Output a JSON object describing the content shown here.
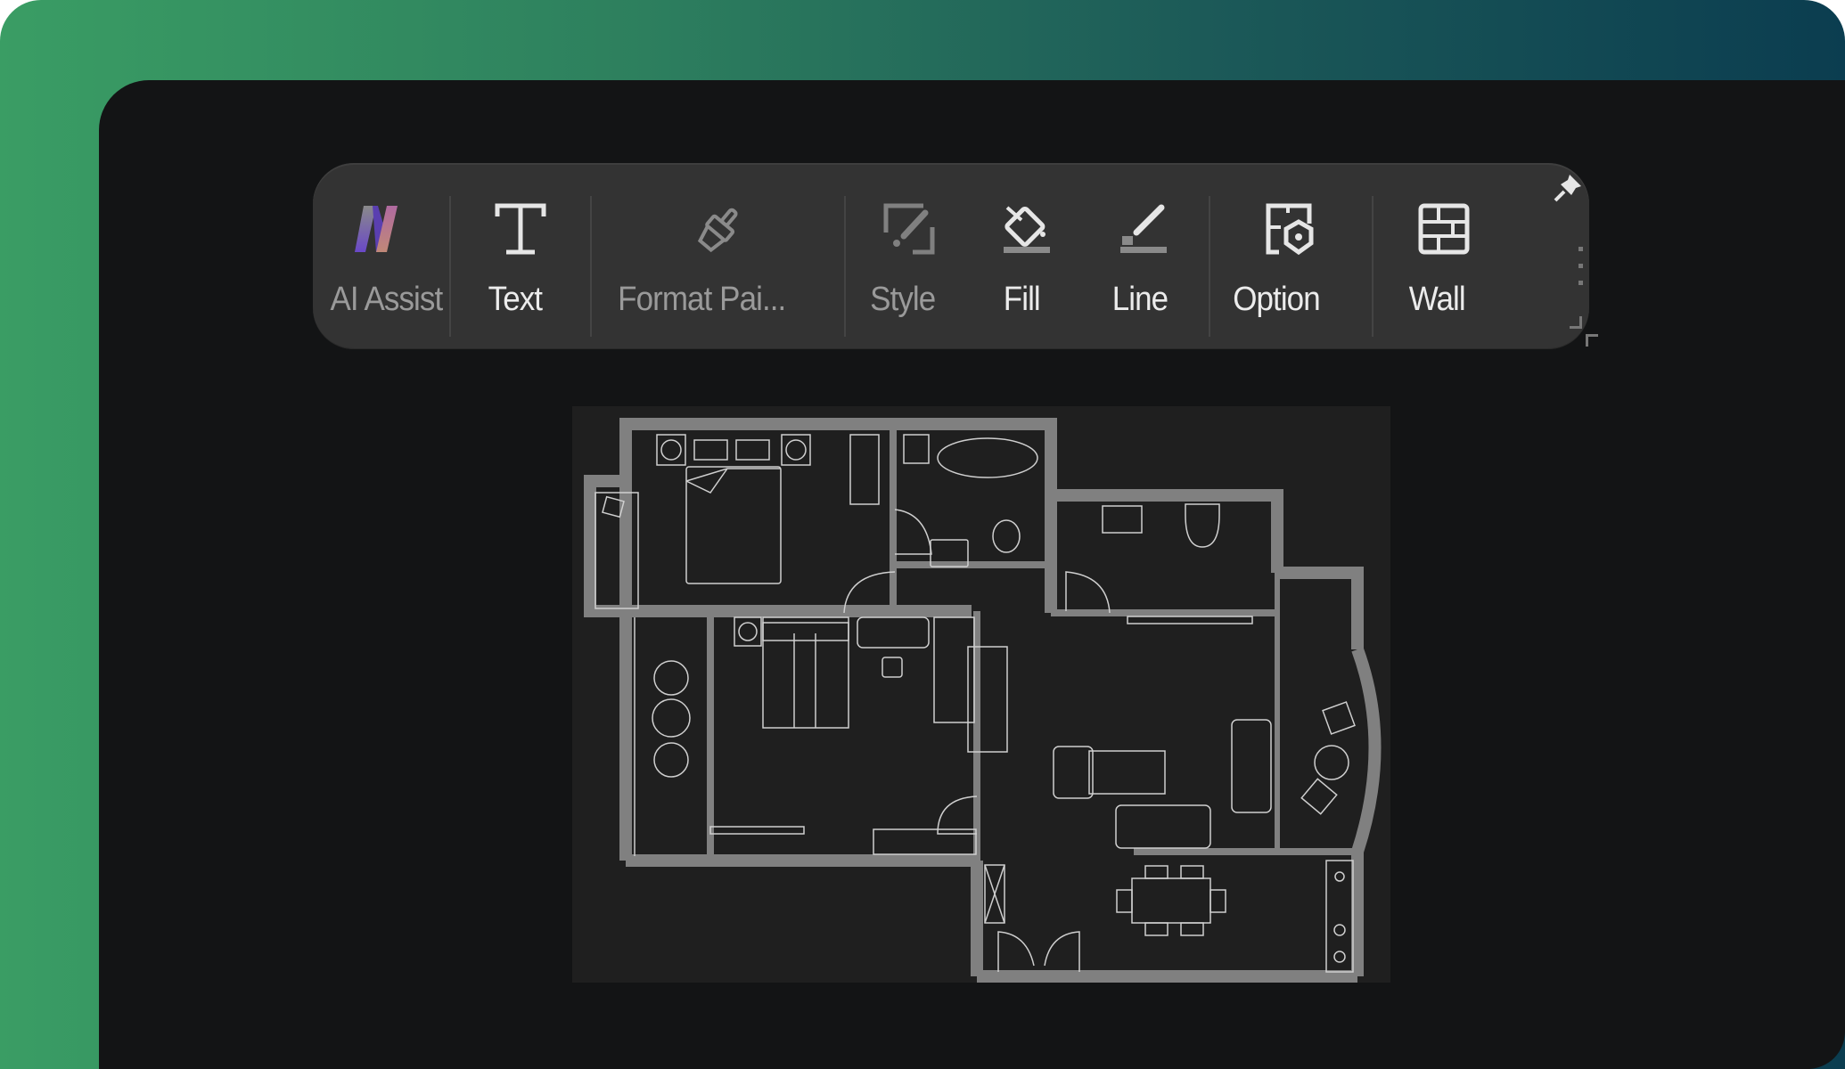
{
  "colors": {
    "backdrop_start": "#3a9d64",
    "backdrop_end": "#0b3d50",
    "window_bg": "#131415",
    "toolbar_bg": "#333333",
    "canvas_bg": "#1f1f1f",
    "wall_color": "#808080",
    "fixture_stroke": "#cfcfcf"
  },
  "toolbar": {
    "items": [
      {
        "id": "ai-assist",
        "label": "AI Assist",
        "icon": "ai-assist-logo-icon",
        "state": "disabled"
      },
      {
        "id": "text",
        "label": "Text",
        "icon": "text-t-icon",
        "state": "enabled"
      },
      {
        "id": "format-painter",
        "label": "Format Pai...",
        "icon": "format-painter-brush-icon",
        "state": "disabled"
      },
      {
        "id": "style",
        "label": "Style",
        "icon": "style-brush-icon",
        "state": "disabled"
      },
      {
        "id": "fill",
        "label": "Fill",
        "icon": "paint-bucket-icon",
        "state": "enabled"
      },
      {
        "id": "line",
        "label": "Line",
        "icon": "line-pen-icon",
        "state": "enabled"
      },
      {
        "id": "option",
        "label": "Option",
        "icon": "option-gear-icon",
        "state": "enabled"
      },
      {
        "id": "wall",
        "label": "Wall",
        "icon": "wall-brick-icon",
        "state": "enabled"
      }
    ],
    "pin_icon": "pin-icon",
    "more_icon": "more-vertical-icon",
    "resize_icon": "resize-corner-icon"
  },
  "canvas": {
    "content": "floor-plan",
    "rooms": [
      "master-bedroom",
      "bathroom",
      "washroom",
      "bedroom",
      "balcony-left",
      "living-room",
      "balcony-right",
      "dining-area",
      "kitchen",
      "entrance-hall"
    ]
  }
}
